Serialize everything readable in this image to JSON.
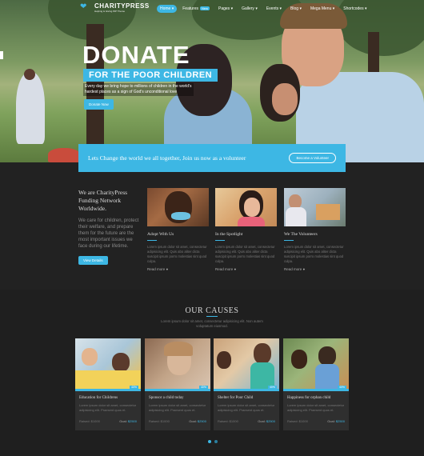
{
  "brand": {
    "name": "CHARITYPRESS",
    "tagline": "Helping & Giving WP Theme"
  },
  "nav": [
    {
      "label": "Home",
      "active": true
    },
    {
      "label": "Features",
      "badge": "New"
    },
    {
      "label": "Pages"
    },
    {
      "label": "Gallery"
    },
    {
      "label": "Events"
    },
    {
      "label": "Blog"
    },
    {
      "label": "Mega Menu"
    },
    {
      "label": "Shortcodes"
    }
  ],
  "hero": {
    "title": "DONATE",
    "subtitle": "FOR THE POOR CHILDREN",
    "description": "Every day we bring hope to millions of children in the world's hardest places as a sign of God's unconditional love",
    "button": "Donate Now"
  },
  "cta": {
    "text": "Lets Change the world we all together, Join us now as a volunteer",
    "button": "Become a Volunteer"
  },
  "about": {
    "title": "We are CharityPress Funding Network Worldwide.",
    "text": "We care for children, protect their welfare, and prepare them for the future are the most important issues we face during our lifetime.",
    "button": "View Details"
  },
  "features": [
    {
      "title": "Adopt With Us",
      "text": "Lorem ipsum dolor sit amet, consectetur adipisicing elit. Quis abo aliter dicta suscipit ipsum porro molestias sint quod culpa.",
      "more": "Read more"
    },
    {
      "title": "In the Spotlight",
      "text": "Lorem ipsum dolor sit amet, consectetur adipisicing elit. Quis abo aliter dicta suscipit ipsum porro molestias sint quod culpa.",
      "more": "Read more"
    },
    {
      "title": "We The Volunteers",
      "text": "Lorem ipsum dolor sit amet, consectetur adipisicing elit. Quis abo aliter dicta suscipit ipsum porro molestias sint quod culpa.",
      "more": "Read more"
    }
  ],
  "causes": {
    "title": "OUR CAUSES",
    "description": "Lorem ipsum dolor sit amet, consectetur adipisicing elit. Non autem voluptatum eiusmod.",
    "items": [
      {
        "title": "Education for Childrens",
        "text": "Lorem ipsum dolor sit amet, consectetur adipisicing elit. Praesent quos et.",
        "raised": "Raised: $1000",
        "goal_label": "Goal:",
        "goal": "$2500",
        "progress": "40%"
      },
      {
        "title": "Sponsor a child today",
        "text": "Lorem ipsum dolor sit amet, consectetur adipisicing elit. Praesent quos et.",
        "raised": "Raised: $1000",
        "goal_label": "Goal:",
        "goal": "$2500",
        "progress": "40%"
      },
      {
        "title": "Shelter for Poor Child",
        "text": "Lorem ipsum dolor sit amet, consectetur adipisicing elit. Praesent quos et.",
        "raised": "Raised: $1000",
        "goal_label": "Goal:",
        "goal": "$2500",
        "progress": "40%"
      },
      {
        "title": "Happiness for orphan child",
        "text": "Lorem ipsum dolor sit amet, consectetur adipisicing elit. Praesent quos et.",
        "raised": "Raised: $1000",
        "goal_label": "Goal:",
        "goal": "$2500",
        "progress": "40%"
      }
    ]
  },
  "colors": {
    "accent": "#3db7e4",
    "background": "#222222",
    "card": "#2f2f2f"
  }
}
